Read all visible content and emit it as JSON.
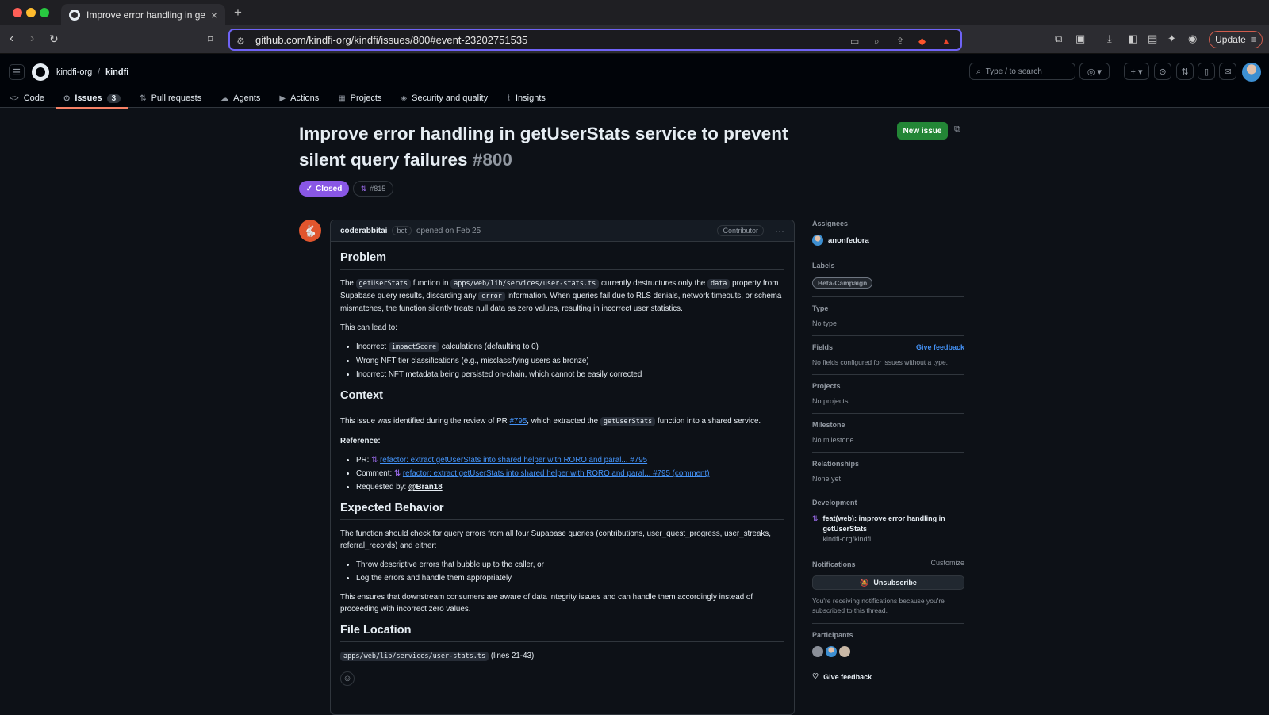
{
  "browser": {
    "tab_title": "Improve error handling in getU",
    "url": "github.com/kindfi-org/kindfi/issues/800#event-23202751535",
    "update_label": "Update"
  },
  "header": {
    "org": "kindfi-org",
    "separator": "/",
    "repo": "kindfi",
    "search_placeholder": "Type / to search",
    "nav": [
      {
        "label": "Code",
        "icon": "code-icon"
      },
      {
        "label": "Issues",
        "icon": "issue-icon",
        "count": "3"
      },
      {
        "label": "Pull requests",
        "icon": "pull-request-icon"
      },
      {
        "label": "Agents",
        "icon": "agent-icon"
      },
      {
        "label": "Actions",
        "icon": "play-icon"
      },
      {
        "label": "Projects",
        "icon": "table-icon"
      },
      {
        "label": "Security and quality",
        "icon": "shield-icon"
      },
      {
        "label": "Insights",
        "icon": "graph-icon"
      }
    ]
  },
  "issue": {
    "title": "Improve error handling in getUserStats service to prevent silent query failures",
    "number": "#800",
    "state": "Closed",
    "linked_pr": "#815",
    "new_issue_label": "New issue"
  },
  "comment": {
    "author": "coderabbitai",
    "bot_tag": "bot",
    "opened": "opened on Feb 25",
    "role": "Contributor",
    "problem_heading": "Problem",
    "p1_a": "The ",
    "p1_code1": "getUserStats",
    "p1_b": " function in ",
    "p1_code2": "apps/web/lib/services/user-stats.ts",
    "p1_c": " currently destructures only the ",
    "p1_code3": "data",
    "p1_d": " property from Supabase query results, discarding any ",
    "p1_code4": "error",
    "p1_e": " information. When queries fail due to RLS denials, network timeouts, or schema mismatches, the function silently treats null data as zero values, resulting in incorrect user statistics.",
    "p2": "This can lead to:",
    "li1_a": "Incorrect ",
    "li1_code": "impactScore",
    "li1_b": " calculations (defaulting to 0)",
    "li2": "Wrong NFT tier classifications (e.g., misclassifying users as bronze)",
    "li3": "Incorrect NFT metadata being persisted on-chain, which cannot be easily corrected",
    "context_heading": "Context",
    "ctx_a": "This issue was identified during the review of PR ",
    "ctx_link": "#795",
    "ctx_b": ", which extracted the ",
    "ctx_code": "getUserStats",
    "ctx_c": " function into a shared service.",
    "reference": "Reference:",
    "ref_pr_label": "PR: ",
    "ref_pr_link": "refactor: extract getUserStats into shared helper with RORO and paral... #795",
    "ref_comment_label": "Comment: ",
    "ref_comment_link": "refactor: extract getUserStats into shared helper with RORO and paral... #795 (comment)",
    "ref_requested_label": "Requested by: ",
    "ref_requested_user": "@Bran18",
    "expected_heading": "Expected Behavior",
    "exp_p": "The function should check for query errors from all four Supabase queries (contributions, user_quest_progress, user_streaks, referral_records) and either:",
    "exp_li1": "Throw descriptive errors that bubble up to the caller, or",
    "exp_li2": "Log the errors and handle them appropriately",
    "exp_p2": "This ensures that downstream consumers are aware of data integrity issues and can handle them accordingly instead of proceeding with incorrect zero values.",
    "file_heading": "File Location",
    "file_code": "apps/web/lib/services/user-stats.ts",
    "file_lines": " (lines 21-43)"
  },
  "sidebar": {
    "assignees_title": "Assignees",
    "assignee": "anonfedora",
    "labels_title": "Labels",
    "label": "Beta-Campaign",
    "type_title": "Type",
    "type_value": "No type",
    "fields_title": "Fields",
    "fields_feedback": "Give feedback",
    "fields_value": "No fields configured for issues without a type.",
    "projects_title": "Projects",
    "projects_value": "No projects",
    "milestone_title": "Milestone",
    "milestone_value": "No milestone",
    "relationships_title": "Relationships",
    "relationships_value": "None yet",
    "development_title": "Development",
    "dev_pr_title": "feat(web): improve error handling in getUserStats",
    "dev_pr_repo": "kindfi-org/kindfi",
    "notifications_title": "Notifications",
    "customize": "Customize",
    "unsubscribe": "Unsubscribe",
    "notif_text": "You're receiving notifications because you're subscribed to this thread.",
    "participants_title": "Participants",
    "give_feedback": "Give feedback"
  },
  "colors": {
    "accent_green": "#238636",
    "closed_purple": "#8957e5",
    "link_blue": "#4493f8",
    "tab_underline": "#f78166"
  }
}
